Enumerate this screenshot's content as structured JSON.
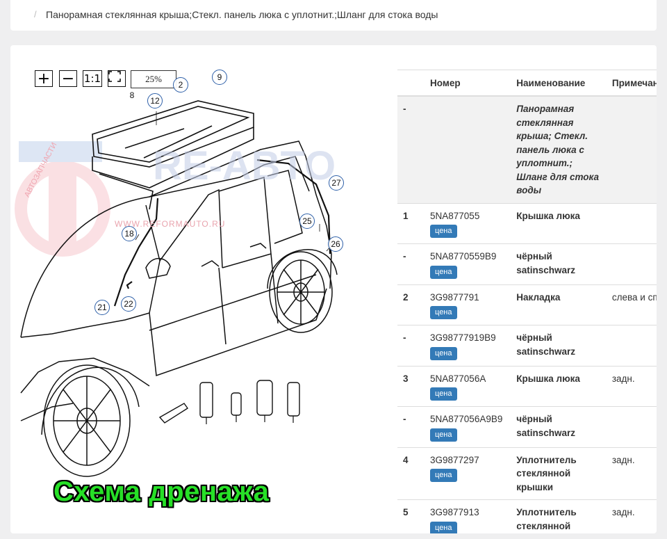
{
  "breadcrumb": {
    "separator": "/",
    "current": "Панорамная стеклянная крыша;Стекл. панель люка с уплотнит.;Шланг для стока воды"
  },
  "diagram": {
    "zoom": {
      "zoom_in_label": "+",
      "zoom_out_label": "−",
      "actual_size_label": "1:1",
      "fit_icon": "fit-screen-icon",
      "zoom_level": "25%"
    },
    "callouts": [
      "2",
      "8",
      "9",
      "12",
      "18",
      "21",
      "22",
      "25",
      "26",
      "27"
    ],
    "watermark": {
      "brand": "RE-ABTO",
      "url": "WWW.REFORMAUTO.RU",
      "sub": "АВТОЗАПЧАСТИ"
    },
    "caption": "Схема дренажа"
  },
  "parts_table": {
    "headers": {
      "pos": "",
      "number": "Номер",
      "name": "Наименование",
      "note": "Примечание"
    },
    "price_label": "цена",
    "accent_color": "#337ab7",
    "rows": [
      {
        "pos": "-",
        "number": "",
        "name": "Панорамная стеклянная крыша; Стекл. панель люка с уплотнит.; Шланг для стока воды",
        "note": "",
        "group": true
      },
      {
        "pos": "1",
        "number": "5NA877055",
        "name": "Крышка люка",
        "note": ""
      },
      {
        "pos": "-",
        "number": "5NA8770559B9",
        "name": "чёрный satinschwarz",
        "note": ""
      },
      {
        "pos": "2",
        "number": "3G9877791",
        "name": "Накладка",
        "note": "слева и справа"
      },
      {
        "pos": "-",
        "number": "3G98777919B9",
        "name": "чёрный satinschwarz",
        "note": ""
      },
      {
        "pos": "3",
        "number": "5NA877056A",
        "name": "Крышка люка",
        "note": "задн."
      },
      {
        "pos": "-",
        "number": "5NA877056A9B9",
        "name": "чёрный satinschwarz",
        "note": ""
      },
      {
        "pos": "4",
        "number": "3G9877297",
        "name": "Уплотнитель стеклянной крышки",
        "note": "задн."
      },
      {
        "pos": "5",
        "number": "3G9877913",
        "name": "Уплотнитель стеклянной",
        "note": "задн."
      }
    ]
  }
}
